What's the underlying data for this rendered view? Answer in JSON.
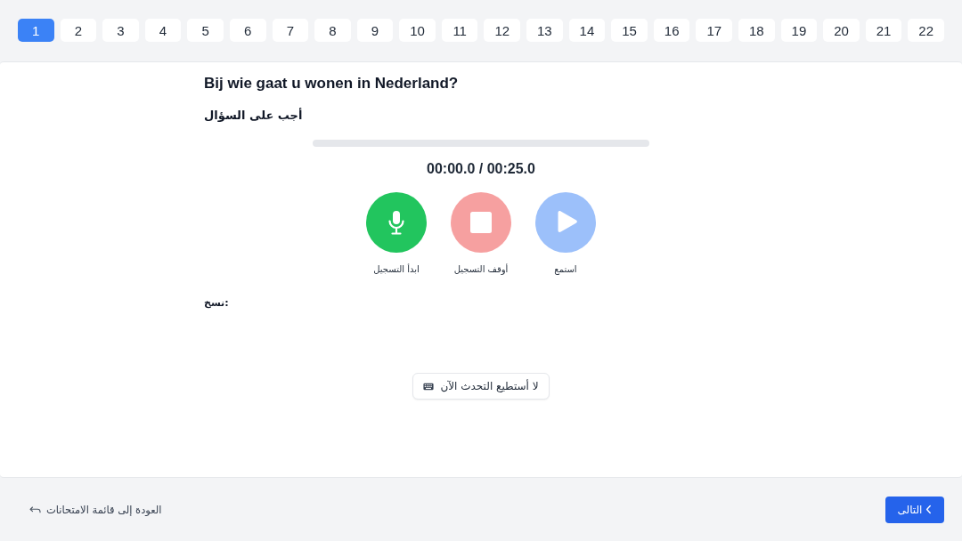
{
  "question_nav": [
    {
      "label": "22",
      "selected": false
    },
    {
      "label": "21",
      "selected": false
    },
    {
      "label": "20",
      "selected": false
    },
    {
      "label": "19",
      "selected": false
    },
    {
      "label": "18",
      "selected": false
    },
    {
      "label": "17",
      "selected": false
    },
    {
      "label": "16",
      "selected": false
    },
    {
      "label": "15",
      "selected": false
    },
    {
      "label": "14",
      "selected": false
    },
    {
      "label": "13",
      "selected": false
    },
    {
      "label": "12",
      "selected": false
    },
    {
      "label": "11",
      "selected": false
    },
    {
      "label": "10",
      "selected": false
    },
    {
      "label": "9",
      "selected": false
    },
    {
      "label": "8",
      "selected": false
    },
    {
      "label": "7",
      "selected": false
    },
    {
      "label": "6",
      "selected": false
    },
    {
      "label": "5",
      "selected": false
    },
    {
      "label": "4",
      "selected": false
    },
    {
      "label": "3",
      "selected": false
    },
    {
      "label": "2",
      "selected": false
    },
    {
      "label": "1",
      "selected": true
    }
  ],
  "question": {
    "title": "Bij wie gaat u wonen in Nederland?",
    "instruction": "أجب على السؤال"
  },
  "player": {
    "time": "00:00.0 / 00:25.0"
  },
  "controls": [
    {
      "kind": "play",
      "label": "استمع",
      "disabled": true
    },
    {
      "kind": "stop",
      "label": "أوقف التسجيل",
      "disabled": true
    },
    {
      "kind": "record",
      "label": "ابدأ التسجيل",
      "disabled": false
    }
  ],
  "transcript": {
    "label": "نسخ:"
  },
  "cannot_speak_button": {
    "label": "لا أستطيع التحدث الآن"
  },
  "footer": {
    "back_link": "العودة إلى قائمة الامتحانات",
    "next_button": "التالى"
  }
}
